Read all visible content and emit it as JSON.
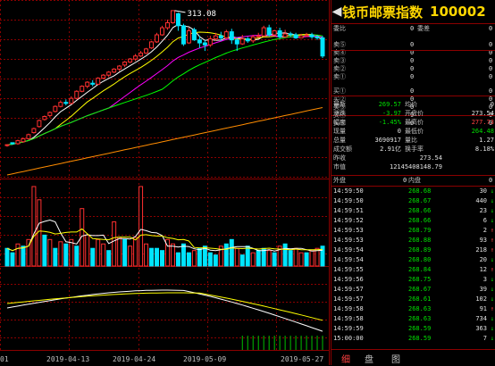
{
  "stock": {
    "name": "钱币邮票指数",
    "code": "100002"
  },
  "kline": {
    "high_label": "313.08",
    "date_labels": [
      "01",
      "2019-04-13",
      "2019-04-24",
      "2019-05-09",
      "2019-05-27"
    ],
    "candles": [
      [
        180,
        180,
        178,
        180
      ],
      [
        182,
        181,
        180,
        181
      ],
      [
        181,
        184,
        180,
        185
      ],
      [
        183,
        186,
        182,
        187
      ],
      [
        186,
        190,
        185,
        191
      ],
      [
        192,
        196,
        191,
        197
      ],
      [
        198,
        204,
        197,
        205
      ],
      [
        205,
        208,
        204,
        209
      ],
      [
        209,
        212,
        207,
        213
      ],
      [
        213,
        218,
        212,
        219
      ],
      [
        218,
        222,
        217,
        224
      ],
      [
        222,
        221,
        219,
        225
      ],
      [
        221,
        226,
        220,
        228
      ],
      [
        226,
        233,
        225,
        234
      ],
      [
        233,
        238,
        232,
        239
      ],
      [
        238,
        242,
        236,
        243
      ],
      [
        241,
        240,
        238,
        244
      ],
      [
        240,
        246,
        239,
        247
      ],
      [
        246,
        249,
        245,
        250
      ],
      [
        249,
        252,
        247,
        253
      ],
      [
        252,
        255,
        251,
        256
      ],
      [
        255,
        258,
        253,
        259
      ],
      [
        259,
        262,
        257,
        263
      ],
      [
        262,
        265,
        261,
        266
      ],
      [
        265,
        268,
        263,
        270
      ],
      [
        268,
        271,
        267,
        273
      ],
      [
        271,
        275,
        270,
        276
      ],
      [
        276,
        282,
        275,
        283
      ],
      [
        282,
        289,
        281,
        291
      ],
      [
        289,
        296,
        288,
        298
      ],
      [
        296,
        301,
        294,
        304
      ],
      [
        301,
        313,
        300,
        313
      ],
      [
        310,
        298,
        293,
        311
      ],
      [
        298,
        280,
        278,
        300
      ],
      [
        281,
        293,
        280,
        296
      ],
      [
        294,
        284,
        283,
        296
      ],
      [
        284,
        281,
        276,
        288
      ],
      [
        281,
        279,
        273,
        284
      ],
      [
        279,
        285,
        277,
        288
      ],
      [
        285,
        288,
        283,
        291
      ],
      [
        288,
        286,
        283,
        292
      ],
      [
        286,
        292,
        285,
        294
      ],
      [
        292,
        284,
        280,
        295
      ],
      [
        284,
        280,
        273,
        286
      ],
      [
        280,
        285,
        279,
        289
      ],
      [
        285,
        283,
        281,
        287
      ],
      [
        283,
        287,
        281,
        289
      ],
      [
        287,
        288,
        286,
        291
      ],
      [
        288,
        296,
        287,
        298
      ],
      [
        296,
        289,
        287,
        299
      ],
      [
        289,
        293,
        288,
        294
      ],
      [
        293,
        287,
        285,
        296
      ],
      [
        287,
        290,
        286,
        294
      ],
      [
        290,
        289,
        287,
        292
      ],
      [
        289,
        286,
        285,
        291
      ],
      [
        286,
        288,
        286,
        290
      ],
      [
        288,
        289,
        287,
        291
      ],
      [
        289,
        287,
        285,
        291
      ],
      [
        287,
        286,
        284,
        289
      ],
      [
        286,
        268,
        266,
        288
      ]
    ],
    "volumes": [
      [
        40,
        "d"
      ],
      [
        30,
        "d"
      ],
      [
        50,
        "u"
      ],
      [
        45,
        "d"
      ],
      [
        60,
        "u"
      ],
      [
        180,
        "u"
      ],
      [
        150,
        "u"
      ],
      [
        70,
        "d"
      ],
      [
        60,
        "u"
      ],
      [
        40,
        "d"
      ],
      [
        55,
        "u"
      ],
      [
        50,
        "d"
      ],
      [
        60,
        "u"
      ],
      [
        45,
        "d"
      ],
      [
        130,
        "u"
      ],
      [
        70,
        "u"
      ],
      [
        40,
        "d"
      ],
      [
        60,
        "u"
      ],
      [
        50,
        "u"
      ],
      [
        35,
        "d"
      ],
      [
        100,
        "u"
      ],
      [
        65,
        "u"
      ],
      [
        60,
        "d"
      ],
      [
        45,
        "u"
      ],
      [
        65,
        "u"
      ],
      [
        180,
        "u"
      ],
      [
        50,
        "u"
      ],
      [
        40,
        "d"
      ],
      [
        40,
        "d"
      ],
      [
        35,
        "d"
      ],
      [
        60,
        "u"
      ],
      [
        50,
        "u"
      ],
      [
        30,
        "d"
      ],
      [
        50,
        "d"
      ],
      [
        30,
        "d"
      ],
      [
        35,
        "u"
      ],
      [
        40,
        "d"
      ],
      [
        45,
        "d"
      ],
      [
        30,
        "d"
      ],
      [
        25,
        "d"
      ],
      [
        45,
        "u"
      ],
      [
        50,
        "d"
      ],
      [
        60,
        "d"
      ],
      [
        40,
        "u"
      ],
      [
        25,
        "d"
      ],
      [
        45,
        "d"
      ],
      [
        30,
        "u"
      ],
      [
        35,
        "d"
      ],
      [
        40,
        "d"
      ],
      [
        35,
        "u"
      ],
      [
        30,
        "d"
      ],
      [
        45,
        "u"
      ],
      [
        50,
        "d"
      ],
      [
        35,
        "d"
      ],
      [
        40,
        "u"
      ],
      [
        30,
        "u"
      ],
      [
        30,
        "d"
      ],
      [
        35,
        "u"
      ],
      [
        40,
        "u"
      ],
      [
        45,
        "d"
      ]
    ]
  },
  "quote": {
    "rows": [
      {
        "label": "委比",
        "mid": "0",
        "label2": "委差",
        "val2": "0"
      },
      {
        "label": "卖⑤",
        "mid": "0",
        "val2": "0"
      },
      {
        "label": "卖④",
        "mid": "0",
        "val2": "0"
      },
      {
        "label": "卖③",
        "mid": "0",
        "val2": "0"
      },
      {
        "label": "卖②",
        "mid": "0",
        "val2": "0"
      },
      {
        "label": "卖①",
        "mid": "0",
        "val2": "0"
      },
      {
        "label": "买①",
        "mid": "0",
        "val2": "0"
      },
      {
        "label": "买②",
        "mid": "0",
        "val2": "0"
      },
      {
        "label": "买③",
        "mid": "0",
        "val2": "0"
      },
      {
        "label": "买④",
        "mid": "0",
        "val2": "0"
      },
      {
        "label": "买⑤",
        "mid": "0",
        "val2": "0"
      }
    ],
    "stats": [
      {
        "l1": "最新",
        "v1": "269.57",
        "c1": "grn",
        "l2": "均价",
        "v2": "0",
        "c2": "wht"
      },
      {
        "l1": "涨跌",
        "v1": "-3.97",
        "c1": "grn",
        "l2": "开盘价",
        "v2": "273.54",
        "c2": "wht"
      },
      {
        "l1": "幅度",
        "v1": "-1.45%",
        "c1": "grn",
        "l2": "最高价",
        "v2": "277.73",
        "c2": "red"
      },
      {
        "l1": "现量",
        "v1": "0",
        "c1": "wht",
        "l2": "最低价",
        "v2": "264.48",
        "c2": "grn"
      },
      {
        "l1": "总量",
        "v1": "3690917",
        "c1": "wht",
        "l2": "量比",
        "v2": "1.27",
        "c2": "wht"
      },
      {
        "l1": "成交额",
        "v1": "2.91亿",
        "c1": "wht",
        "l2": "换手率",
        "v2": "8.18%",
        "c2": "wht"
      },
      {
        "l1": "昨收",
        "v1": "273.54",
        "c1": "wht",
        "l2": "",
        "v2": "",
        "c2": "wht"
      },
      {
        "l1": "市值",
        "v1": "12145408148.79",
        "c1": "wht",
        "l2": "",
        "v2": "",
        "c2": "wht"
      }
    ],
    "outer_label": "外盘",
    "outer_val": "0",
    "inner_label": "内盘",
    "inner_val": "0"
  },
  "ticks": [
    {
      "t": "14:59:50",
      "p": "268.68",
      "v": "30",
      "d": "down"
    },
    {
      "t": "14:59:50",
      "p": "268.67",
      "v": "440",
      "d": "down"
    },
    {
      "t": "14:59:51",
      "p": "268.66",
      "v": "23",
      "d": "down"
    },
    {
      "t": "14:59:52",
      "p": "268.66",
      "v": "6",
      "d": "down"
    },
    {
      "t": "14:59:53",
      "p": "268.79",
      "v": "2",
      "d": "up"
    },
    {
      "t": "14:59:53",
      "p": "268.88",
      "v": "93",
      "d": "up"
    },
    {
      "t": "14:59:54",
      "p": "268.89",
      "v": "218",
      "d": "up"
    },
    {
      "t": "14:59:54",
      "p": "268.80",
      "v": "20",
      "d": "down"
    },
    {
      "t": "14:59:55",
      "p": "268.84",
      "v": "12",
      "d": "up"
    },
    {
      "t": "14:59:56",
      "p": "268.75",
      "v": "3",
      "d": "down"
    },
    {
      "t": "14:59:57",
      "p": "268.67",
      "v": "39",
      "d": "down"
    },
    {
      "t": "14:59:57",
      "p": "268.61",
      "v": "102",
      "d": "down"
    },
    {
      "t": "14:59:58",
      "p": "268.63",
      "v": "91",
      "d": "up"
    },
    {
      "t": "14:59:58",
      "p": "268.63",
      "v": "734",
      "d": "down"
    },
    {
      "t": "14:59:59",
      "p": "268.59",
      "v": "363",
      "d": "down"
    },
    {
      "t": "15:00:00",
      "p": "268.59",
      "v": "7",
      "d": "down"
    }
  ],
  "tabs": [
    "细",
    "盘",
    "图"
  ],
  "icons": {
    "left_arrow": "◀",
    "up_arrow": "↑",
    "down_arrow": "↓"
  },
  "colors": {
    "up": "#ff3030",
    "down": "#00e5ff",
    "gold": "#ffd700",
    "grid": "#8b0000"
  }
}
